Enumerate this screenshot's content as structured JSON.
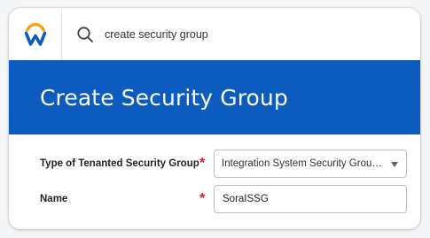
{
  "app": {
    "logo_icon": "workday-logo-icon",
    "brand_colors": {
      "arc": "#f6a517",
      "w": "#0b5cbe"
    }
  },
  "search": {
    "icon": "search-icon",
    "value": "create security group"
  },
  "header": {
    "title": "Create Security Group",
    "background": "#0b5cbe"
  },
  "form": {
    "type_field": {
      "label": "Type of Tenanted Security Group",
      "required_mark": "*",
      "selected_value": "Integration System Security Group (Unconstrained)"
    },
    "name_field": {
      "label": "Name",
      "required_mark": "*",
      "value": "SoraISSG"
    }
  }
}
